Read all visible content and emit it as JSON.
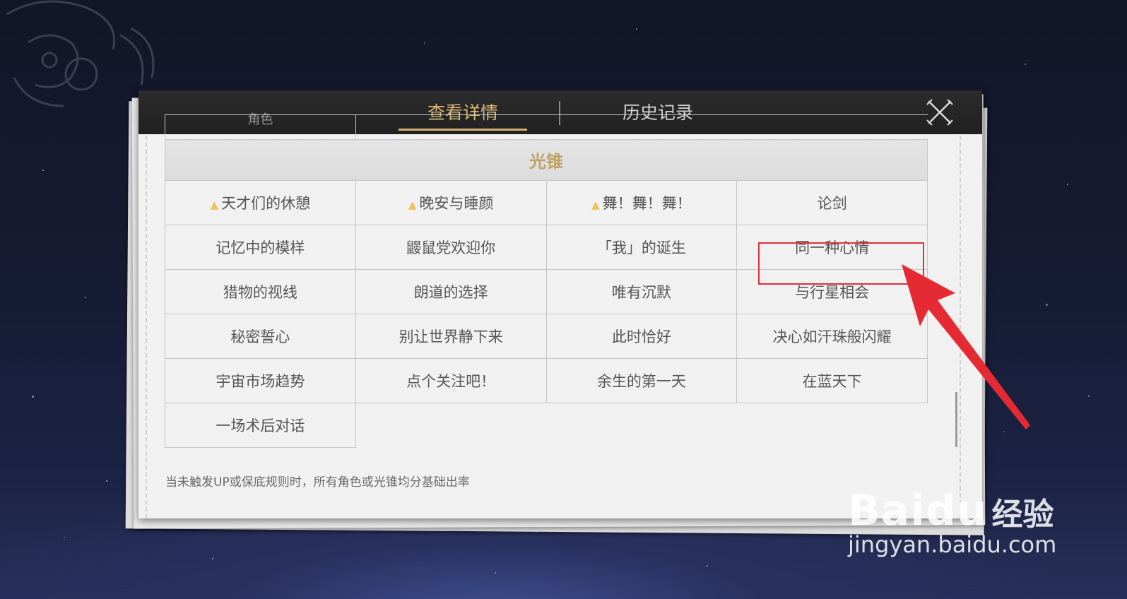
{
  "tabs": {
    "details": "查看详情",
    "history": "历史记录"
  },
  "icons": {
    "close": "close-icon",
    "up_marker": "up-marker-icon",
    "arrow": "red-arrow",
    "doodle": "doodle-icon"
  },
  "grid": {
    "partial_row_text": "角色",
    "section_title": "光锥",
    "rows": [
      [
        {
          "label": "天才们的休憩",
          "up": true
        },
        {
          "label": "晚安与睡颜",
          "up": true
        },
        {
          "label": "舞！舞！舞！",
          "up": true
        },
        {
          "label": "论剑",
          "up": false
        }
      ],
      [
        {
          "label": "记忆中的模样"
        },
        {
          "label": "鼹鼠党欢迎你"
        },
        {
          "label": "「我」的诞生"
        },
        {
          "label": "同一种心情"
        }
      ],
      [
        {
          "label": "猎物的视线"
        },
        {
          "label": "朗道的选择"
        },
        {
          "label": "唯有沉默"
        },
        {
          "label": "与行星相会"
        }
      ],
      [
        {
          "label": "秘密誓心"
        },
        {
          "label": "别让世界静下来"
        },
        {
          "label": "此时恰好"
        },
        {
          "label": "决心如汗珠般闪耀"
        }
      ],
      [
        {
          "label": "宇宙市场趋势"
        },
        {
          "label": "点个关注吧！"
        },
        {
          "label": "余生的第一天"
        },
        {
          "label": "在蓝天下"
        }
      ],
      [
        {
          "label": "一场术后对话"
        }
      ]
    ]
  },
  "footer_note": "当未触发UP或保底规则时，所有角色或光锥均分基础出率",
  "watermark": {
    "brand": "Bai",
    "brand2": "du",
    "cn": "经验",
    "url": "jingyan.baidu.com"
  },
  "colors": {
    "accent_gold": "#d3b06f",
    "highlight_red": "#e0313a",
    "up_marker": "#f2c25a"
  }
}
